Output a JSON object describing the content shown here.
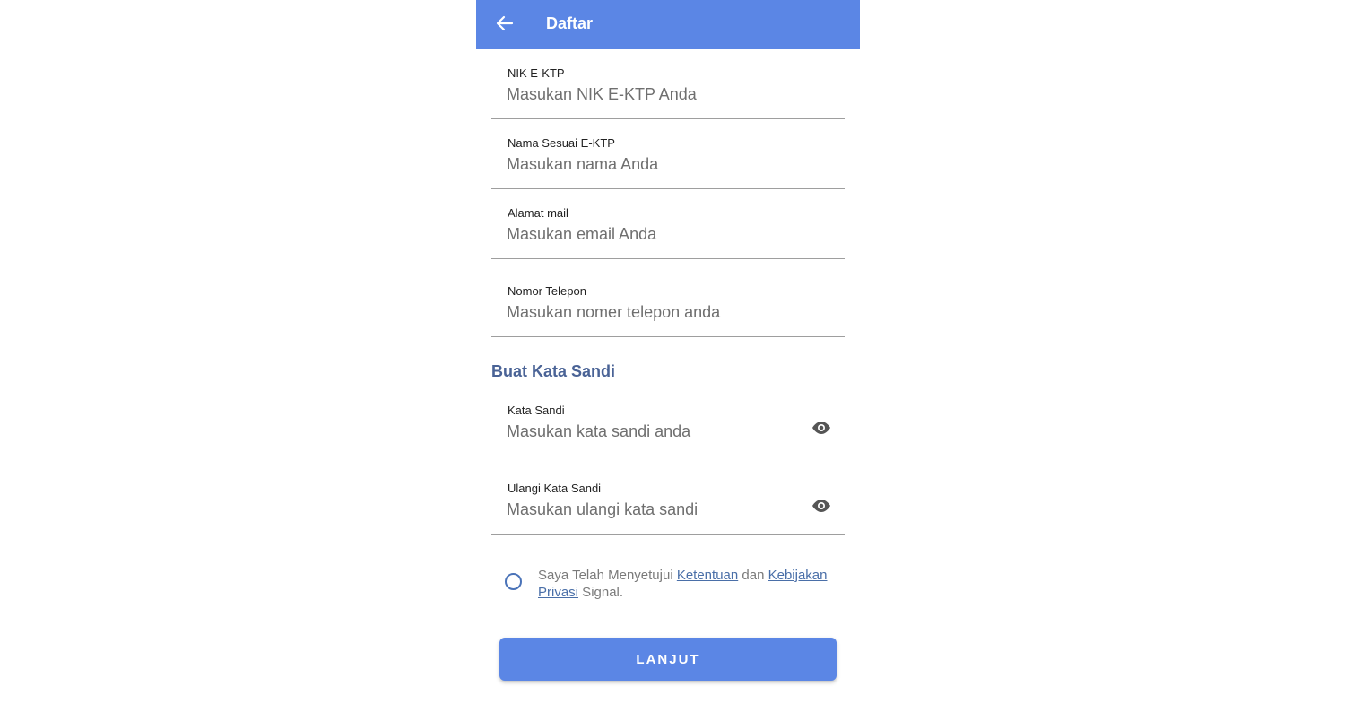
{
  "appbar": {
    "title": "Daftar",
    "back_icon": "arrow-left-icon",
    "color": "#5b86e5"
  },
  "form": {
    "nik": {
      "label": "NIK E-KTP",
      "placeholder": "Masukan NIK E-KTP Anda",
      "value": ""
    },
    "name": {
      "label": "Nama Sesuai E-KTP",
      "placeholder": "Masukan nama Anda",
      "value": ""
    },
    "email": {
      "label": "Alamat mail",
      "placeholder": "Masukan email Anda",
      "value": ""
    },
    "phone": {
      "label": "Nomor Telepon",
      "placeholder": "Masukan nomer telepon anda",
      "value": ""
    }
  },
  "password_section": {
    "title": "Buat Kata Sandi",
    "password": {
      "label": "Kata Sandi",
      "placeholder": "Masukan kata sandi anda",
      "icon": "eye-icon"
    },
    "confirm": {
      "label": "Ulangi Kata Sandi",
      "placeholder": "Masukan ulangi kata sandi",
      "icon": "eye-icon"
    }
  },
  "agreement": {
    "prefix": "Saya Telah Menyetujui ",
    "terms_link": "Ketentuan",
    "middle": " dan ",
    "privacy_link": "Kebijakan Privasi",
    "suffix": " Signal.",
    "checked": false
  },
  "submit": {
    "label": "LANJUT"
  }
}
